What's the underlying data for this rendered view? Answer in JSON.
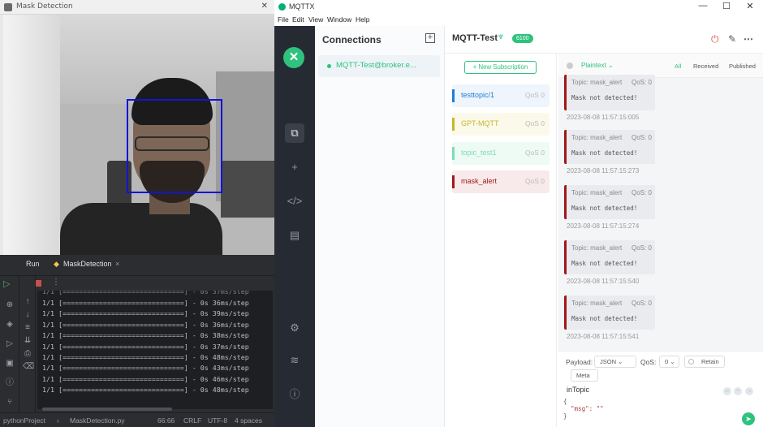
{
  "mask_window": {
    "title": "Mask Detection",
    "close": "✕"
  },
  "ide": {
    "tabs": {
      "run": "Run",
      "file_tab": "MaskDetection",
      "close": "×"
    },
    "console_lines": [
      "1/1 [==============================] - 0s 36ms/step",
      "1/1 [==============================] - 0s 39ms/step",
      "1/1 [==============================] - 0s 36ms/step",
      "1/1 [==============================] - 0s 38ms/step",
      "1/1 [==============================] - 0s 37ms/step",
      "1/1 [==============================] - 0s 48ms/step",
      "1/1 [==============================] - 0s 43ms/step",
      "1/1 [==============================] - 0s 46ms/step",
      "1/1 [==============================] - 0s 48ms/step"
    ],
    "status": {
      "project": "pythonProject",
      "file": "MaskDetection.py",
      "position": "66:66",
      "line_sep": "CRLF",
      "encoding": "UTF-8",
      "indent": "4 spaces"
    }
  },
  "mqttx": {
    "title": "MQTTX",
    "menu": [
      "File",
      "Edit",
      "View",
      "Window",
      "Help"
    ],
    "connections_heading": "Connections",
    "connection_item": "MQTT-Test@broker.e...",
    "header": {
      "name": "MQTT-Test",
      "badge": "6100"
    },
    "new_subscription": "New Subscription",
    "topics": [
      {
        "name": "testtopic/1",
        "qos": "QoS 0",
        "color": "#1e7fd6",
        "bg": "#eef5fc"
      },
      {
        "name": "GPT-MQTT",
        "qos": "QoS 0",
        "color": "#c6b62a",
        "bg": "#fbf9ea"
      },
      {
        "name": "topic_test1",
        "qos": "QoS 0",
        "color": "#7ddcb5",
        "bg": "#eefaf4"
      },
      {
        "name": "mask_alert",
        "qos": "QoS 0",
        "color": "#a01818",
        "bg": "#f8eaea"
      }
    ],
    "payload_format": "Plaintext",
    "filters": {
      "all": "All",
      "received": "Received",
      "published": "Published"
    },
    "messages": [
      {
        "topic": "Topic: mask_alert",
        "qos": "QoS: 0",
        "payload": "Mask not detected!",
        "time": "2023-08-08 11:57:15:005"
      },
      {
        "topic": "Topic: mask_alert",
        "qos": "QoS: 0",
        "payload": "Mask not detected!",
        "time": "2023-08-08 11:57:15:273"
      },
      {
        "topic": "Topic: mask_alert",
        "qos": "QoS: 0",
        "payload": "Mask not detected!",
        "time": "2023-08-08 11:57:15:274"
      },
      {
        "topic": "Topic: mask_alert",
        "qos": "QoS: 0",
        "payload": "Mask not detected!",
        "time": "2023-08-08 11:57:15:540"
      },
      {
        "topic": "Topic: mask_alert",
        "qos": "QoS: 0",
        "payload": "Mask not detected!",
        "time": "2023-08-08 11:57:15:541"
      }
    ],
    "publish": {
      "payload_label": "Payload:",
      "payload_type": "JSON",
      "qos_label": "QoS:",
      "qos_value": "0",
      "retain": "Retain",
      "meta": "Meta",
      "topic": "inTopic",
      "editor_lines": [
        "{",
        "  \"msg\": \"\"",
        "}"
      ]
    }
  }
}
